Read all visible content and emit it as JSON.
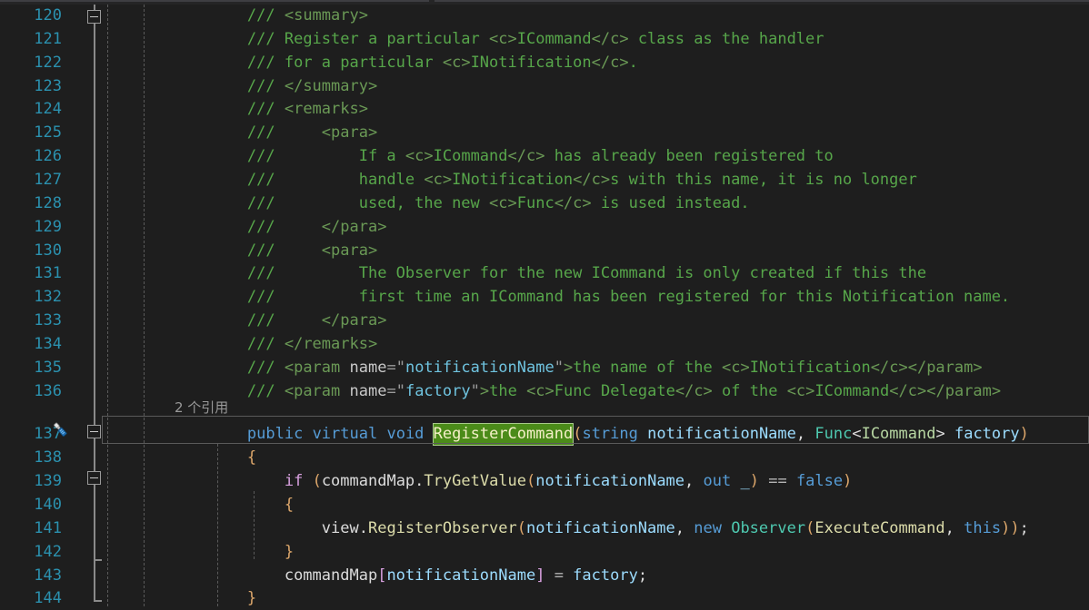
{
  "editor": {
    "language": "csharp",
    "background": "#1E1E1E",
    "line_number_color": "#2B91AF",
    "highlight_chip_color": "#4B8B19",
    "current_line_border_color": "#5A5A5A",
    "first_visible_line": 120,
    "last_visible_line": 144
  },
  "codelens": {
    "text": "2 个引用",
    "attached_to_line": 137
  },
  "gutter": {
    "quick_action_icon": "screwdriver-icon",
    "quick_action_line": 137,
    "fold_markers": [
      {
        "line": 120,
        "state": "expanded"
      },
      {
        "line": 137,
        "state": "expanded"
      },
      {
        "line": 139,
        "state": "expanded"
      }
    ]
  },
  "lines": [
    {
      "number": 120,
      "tokens": [
        {
          "t": "        ",
          "c": "t-punc"
        },
        {
          "t": "/// ",
          "c": "t-doc"
        },
        {
          "t": "<summary>",
          "c": "t-doctag"
        }
      ]
    },
    {
      "number": 121,
      "tokens": [
        {
          "t": "        ",
          "c": "t-punc"
        },
        {
          "t": "/// ",
          "c": "t-doc"
        },
        {
          "t": "Register a particular ",
          "c": "t-doc"
        },
        {
          "t": "<c>",
          "c": "t-doctag"
        },
        {
          "t": "ICommand",
          "c": "t-doc"
        },
        {
          "t": "</c>",
          "c": "t-doctag"
        },
        {
          "t": " class as the handler",
          "c": "t-doc"
        }
      ]
    },
    {
      "number": 122,
      "tokens": [
        {
          "t": "        ",
          "c": "t-punc"
        },
        {
          "t": "/// ",
          "c": "t-doc"
        },
        {
          "t": "for a particular ",
          "c": "t-doc"
        },
        {
          "t": "<c>",
          "c": "t-doctag"
        },
        {
          "t": "INotification",
          "c": "t-doc"
        },
        {
          "t": "</c>",
          "c": "t-doctag"
        },
        {
          "t": ".",
          "c": "t-doc"
        }
      ]
    },
    {
      "number": 123,
      "tokens": [
        {
          "t": "        ",
          "c": "t-punc"
        },
        {
          "t": "/// ",
          "c": "t-doc"
        },
        {
          "t": "</summary>",
          "c": "t-doctag"
        }
      ]
    },
    {
      "number": 124,
      "tokens": [
        {
          "t": "        ",
          "c": "t-punc"
        },
        {
          "t": "/// ",
          "c": "t-doc"
        },
        {
          "t": "<remarks>",
          "c": "t-doctag"
        }
      ]
    },
    {
      "number": 125,
      "tokens": [
        {
          "t": "        ",
          "c": "t-punc"
        },
        {
          "t": "/// ",
          "c": "t-doc"
        },
        {
          "t": "    ",
          "c": "t-doc"
        },
        {
          "t": "<para>",
          "c": "t-doctag"
        }
      ]
    },
    {
      "number": 126,
      "tokens": [
        {
          "t": "        ",
          "c": "t-punc"
        },
        {
          "t": "/// ",
          "c": "t-doc"
        },
        {
          "t": "        If a ",
          "c": "t-doc"
        },
        {
          "t": "<c>",
          "c": "t-doctag"
        },
        {
          "t": "ICommand",
          "c": "t-doc"
        },
        {
          "t": "</c>",
          "c": "t-doctag"
        },
        {
          "t": " has already been registered to",
          "c": "t-doc"
        }
      ]
    },
    {
      "number": 127,
      "tokens": [
        {
          "t": "        ",
          "c": "t-punc"
        },
        {
          "t": "/// ",
          "c": "t-doc"
        },
        {
          "t": "        handle ",
          "c": "t-doc"
        },
        {
          "t": "<c>",
          "c": "t-doctag"
        },
        {
          "t": "INotification",
          "c": "t-doc"
        },
        {
          "t": "</c>",
          "c": "t-doctag"
        },
        {
          "t": "s with this name, it is no longer",
          "c": "t-doc"
        }
      ]
    },
    {
      "number": 128,
      "tokens": [
        {
          "t": "        ",
          "c": "t-punc"
        },
        {
          "t": "/// ",
          "c": "t-doc"
        },
        {
          "t": "        used, the new ",
          "c": "t-doc"
        },
        {
          "t": "<c>",
          "c": "t-doctag"
        },
        {
          "t": "Func",
          "c": "t-doc"
        },
        {
          "t": "</c>",
          "c": "t-doctag"
        },
        {
          "t": " is used instead.",
          "c": "t-doc"
        }
      ]
    },
    {
      "number": 129,
      "tokens": [
        {
          "t": "        ",
          "c": "t-punc"
        },
        {
          "t": "/// ",
          "c": "t-doc"
        },
        {
          "t": "    ",
          "c": "t-doc"
        },
        {
          "t": "</para>",
          "c": "t-doctag"
        }
      ]
    },
    {
      "number": 130,
      "tokens": [
        {
          "t": "        ",
          "c": "t-punc"
        },
        {
          "t": "/// ",
          "c": "t-doc"
        },
        {
          "t": "    ",
          "c": "t-doc"
        },
        {
          "t": "<para>",
          "c": "t-doctag"
        }
      ]
    },
    {
      "number": 131,
      "tokens": [
        {
          "t": "        ",
          "c": "t-punc"
        },
        {
          "t": "/// ",
          "c": "t-doc"
        },
        {
          "t": "        The Observer for the new ICommand is only created if this the",
          "c": "t-doc"
        }
      ]
    },
    {
      "number": 132,
      "tokens": [
        {
          "t": "        ",
          "c": "t-punc"
        },
        {
          "t": "/// ",
          "c": "t-doc"
        },
        {
          "t": "        first time an ICommand has been registered for this Notification name.",
          "c": "t-doc"
        }
      ]
    },
    {
      "number": 133,
      "tokens": [
        {
          "t": "        ",
          "c": "t-punc"
        },
        {
          "t": "/// ",
          "c": "t-doc"
        },
        {
          "t": "    ",
          "c": "t-doc"
        },
        {
          "t": "</para>",
          "c": "t-doctag"
        }
      ]
    },
    {
      "number": 134,
      "tokens": [
        {
          "t": "        ",
          "c": "t-punc"
        },
        {
          "t": "/// ",
          "c": "t-doc"
        },
        {
          "t": "</remarks>",
          "c": "t-doctag"
        }
      ]
    },
    {
      "number": 135,
      "tokens": [
        {
          "t": "        ",
          "c": "t-punc"
        },
        {
          "t": "/// ",
          "c": "t-doc"
        },
        {
          "t": "<param ",
          "c": "t-doctag"
        },
        {
          "t": "name",
          "c": "t-docattrname"
        },
        {
          "t": "=",
          "c": "t-docquote"
        },
        {
          "t": "\"",
          "c": "t-docquote"
        },
        {
          "t": "notificationName",
          "c": "t-docattrval"
        },
        {
          "t": "\"",
          "c": "t-docquote"
        },
        {
          "t": ">",
          "c": "t-doctag"
        },
        {
          "t": "the name of the ",
          "c": "t-doc"
        },
        {
          "t": "<c>",
          "c": "t-doctag"
        },
        {
          "t": "INotification",
          "c": "t-doc"
        },
        {
          "t": "</c>",
          "c": "t-doctag"
        },
        {
          "t": "</param>",
          "c": "t-doctag"
        }
      ]
    },
    {
      "number": 136,
      "tokens": [
        {
          "t": "        ",
          "c": "t-punc"
        },
        {
          "t": "/// ",
          "c": "t-doc"
        },
        {
          "t": "<param ",
          "c": "t-doctag"
        },
        {
          "t": "name",
          "c": "t-docattrname"
        },
        {
          "t": "=",
          "c": "t-docquote"
        },
        {
          "t": "\"",
          "c": "t-docquote"
        },
        {
          "t": "factory",
          "c": "t-docattrval"
        },
        {
          "t": "\"",
          "c": "t-docquote"
        },
        {
          "t": ">",
          "c": "t-doctag"
        },
        {
          "t": "the ",
          "c": "t-doc"
        },
        {
          "t": "<c>",
          "c": "t-doctag"
        },
        {
          "t": "Func Delegate",
          "c": "t-doc"
        },
        {
          "t": "</c>",
          "c": "t-doctag"
        },
        {
          "t": " of the ",
          "c": "t-doc"
        },
        {
          "t": "<c>",
          "c": "t-doctag"
        },
        {
          "t": "ICommand",
          "c": "t-doc"
        },
        {
          "t": "</c>",
          "c": "t-doctag"
        },
        {
          "t": "</param>",
          "c": "t-doctag"
        }
      ]
    },
    {
      "number": 137,
      "current": true,
      "tokens": [
        {
          "t": "        ",
          "c": "t-punc"
        },
        {
          "t": "public",
          "c": "t-kw"
        },
        {
          "t": " ",
          "c": "t-punc"
        },
        {
          "t": "virtual",
          "c": "t-kw"
        },
        {
          "t": " ",
          "c": "t-punc"
        },
        {
          "t": "void",
          "c": "t-kw"
        },
        {
          "t": " ",
          "c": "t-punc"
        },
        {
          "t": "RegisterCommand",
          "c": "name-chip"
        },
        {
          "t": "(",
          "c": "t-paren"
        },
        {
          "t": "string",
          "c": "t-kw"
        },
        {
          "t": " ",
          "c": "t-punc"
        },
        {
          "t": "notificationName",
          "c": "t-param"
        },
        {
          "t": ", ",
          "c": "t-punc"
        },
        {
          "t": "Func",
          "c": "t-type"
        },
        {
          "t": "<",
          "c": "t-angle"
        },
        {
          "t": "ICommand",
          "c": "t-iface"
        },
        {
          "t": ">",
          "c": "t-angle"
        },
        {
          "t": " ",
          "c": "t-punc"
        },
        {
          "t": "factory",
          "c": "t-param"
        },
        {
          "t": ")",
          "c": "t-paren"
        }
      ]
    },
    {
      "number": 138,
      "tokens": [
        {
          "t": "        ",
          "c": "t-punc"
        },
        {
          "t": "{",
          "c": "t-brace"
        }
      ]
    },
    {
      "number": 139,
      "tokens": [
        {
          "t": "            ",
          "c": "t-punc"
        },
        {
          "t": "if",
          "c": "t-ctrlkw"
        },
        {
          "t": " ",
          "c": "t-punc"
        },
        {
          "t": "(",
          "c": "t-paren"
        },
        {
          "t": "commandMap",
          "c": "t-local"
        },
        {
          "t": ".",
          "c": "t-punc"
        },
        {
          "t": "TryGetValue",
          "c": "t-method"
        },
        {
          "t": "(",
          "c": "t-paren"
        },
        {
          "t": "notificationName",
          "c": "t-param"
        },
        {
          "t": ", ",
          "c": "t-punc"
        },
        {
          "t": "out",
          "c": "t-kw"
        },
        {
          "t": " ",
          "c": "t-punc"
        },
        {
          "t": "_",
          "c": "t-param"
        },
        {
          "t": ")",
          "c": "t-paren"
        },
        {
          "t": " == ",
          "c": "t-op"
        },
        {
          "t": "false",
          "c": "t-kw"
        },
        {
          "t": ")",
          "c": "t-paren"
        }
      ]
    },
    {
      "number": 140,
      "tokens": [
        {
          "t": "            ",
          "c": "t-punc"
        },
        {
          "t": "{",
          "c": "t-brace"
        }
      ]
    },
    {
      "number": 141,
      "tokens": [
        {
          "t": "                ",
          "c": "t-punc"
        },
        {
          "t": "view",
          "c": "t-local"
        },
        {
          "t": ".",
          "c": "t-punc"
        },
        {
          "t": "RegisterObserver",
          "c": "t-method"
        },
        {
          "t": "(",
          "c": "t-paren"
        },
        {
          "t": "notificationName",
          "c": "t-param"
        },
        {
          "t": ", ",
          "c": "t-punc"
        },
        {
          "t": "new",
          "c": "t-kw"
        },
        {
          "t": " ",
          "c": "t-punc"
        },
        {
          "t": "Observer",
          "c": "t-type"
        },
        {
          "t": "(",
          "c": "t-paren"
        },
        {
          "t": "ExecuteCommand",
          "c": "t-method"
        },
        {
          "t": ", ",
          "c": "t-punc"
        },
        {
          "t": "this",
          "c": "t-kw"
        },
        {
          "t": "))",
          "c": "t-paren"
        },
        {
          "t": ";",
          "c": "t-punc"
        }
      ]
    },
    {
      "number": 142,
      "tokens": [
        {
          "t": "            ",
          "c": "t-punc"
        },
        {
          "t": "}",
          "c": "t-brace"
        }
      ]
    },
    {
      "number": 143,
      "tokens": [
        {
          "t": "            ",
          "c": "t-punc"
        },
        {
          "t": "commandMap",
          "c": "t-local"
        },
        {
          "t": "[",
          "c": "t-bracket"
        },
        {
          "t": "notificationName",
          "c": "t-param"
        },
        {
          "t": "]",
          "c": "t-bracket"
        },
        {
          "t": " = ",
          "c": "t-op"
        },
        {
          "t": "factory",
          "c": "t-param"
        },
        {
          "t": ";",
          "c": "t-punc"
        }
      ]
    },
    {
      "number": 144,
      "tokens": [
        {
          "t": "        ",
          "c": "t-punc"
        },
        {
          "t": "}",
          "c": "t-brace"
        }
      ]
    }
  ]
}
